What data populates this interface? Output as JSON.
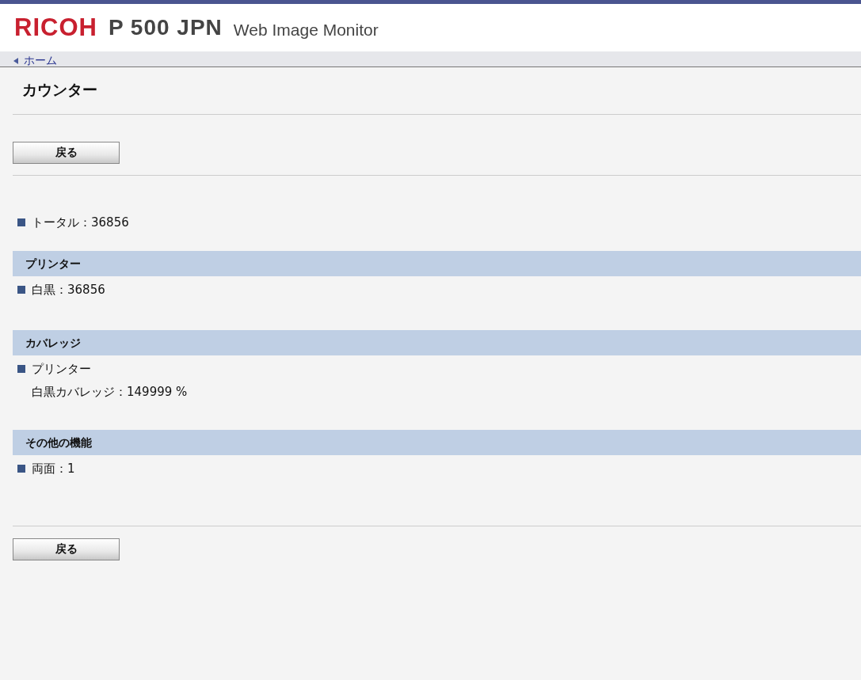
{
  "header": {
    "logo": "RICOH",
    "model": "P 500 JPN",
    "app_title": "Web Image Monitor"
  },
  "breadcrumb": {
    "label": "ホーム"
  },
  "page_title": "カウンター",
  "top_button": "戻る",
  "total": {
    "text": "トータル：36856"
  },
  "sections": [
    {
      "heading": "プリンター",
      "items": [
        {
          "text": "白黒：36856"
        }
      ]
    },
    {
      "heading": "カバレッジ",
      "items": [
        {
          "text": "プリンター",
          "sub": "白黒カバレッジ：149999 %"
        }
      ]
    },
    {
      "heading": "その他の機能",
      "items": [
        {
          "text": "両面：1"
        }
      ]
    }
  ],
  "bottom_button": "戻る"
}
